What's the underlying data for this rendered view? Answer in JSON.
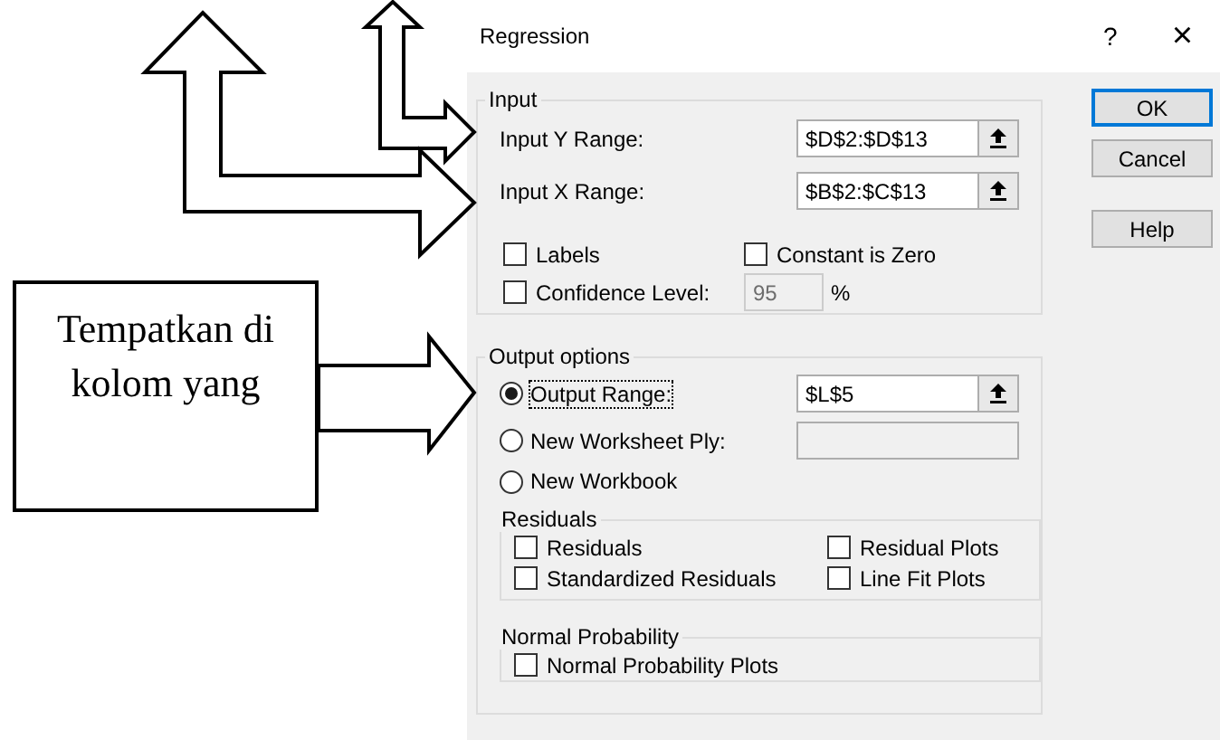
{
  "annotations": {
    "callout": "Tempatkan di kolom yang"
  },
  "window": {
    "title": "Regression",
    "help_glyph": "?",
    "close_glyph": "×"
  },
  "input": {
    "legend": "Input",
    "ranges": [
      {
        "label": "Input Y Range:",
        "value": "$D$2:$D$13"
      },
      {
        "label": "Input X Range:",
        "value": "$B$2:$C$13"
      }
    ],
    "options": [
      {
        "kind": "checkbox",
        "label": "Labels",
        "checked": false
      },
      {
        "kind": "checkbox",
        "label": "Constant is Zero",
        "checked": false
      },
      {
        "kind": "checkbox-field",
        "label": "Confidence Level:",
        "checked": false,
        "value": "95",
        "disabled": true,
        "suffix": "%"
      }
    ]
  },
  "buttons": [
    {
      "label": "OK",
      "default": true
    },
    {
      "label": "Cancel",
      "default": false
    },
    {
      "label": "Help",
      "default": false
    }
  ],
  "output": {
    "legend": "Output options",
    "choices": [
      {
        "label": "Output Range:",
        "selected": true,
        "focused": true,
        "kind": "range",
        "value": "$L$5"
      },
      {
        "label": "New Worksheet Ply:",
        "selected": false,
        "focused": false,
        "kind": "field",
        "disabled": true
      },
      {
        "label": "New Workbook",
        "selected": false,
        "focused": false,
        "kind": "plain"
      }
    ],
    "residuals": {
      "legend": "Residuals",
      "options": [
        {
          "label": "Residuals",
          "checked": false
        },
        {
          "label": "Residual Plots",
          "checked": false
        },
        {
          "label": "Standardized Residuals",
          "checked": false
        },
        {
          "label": "Line Fit Plots",
          "checked": false
        }
      ]
    },
    "normal_probability": {
      "legend": "Normal Probability",
      "options": [
        {
          "label": "Normal Probability Plots",
          "checked": false
        }
      ]
    }
  }
}
